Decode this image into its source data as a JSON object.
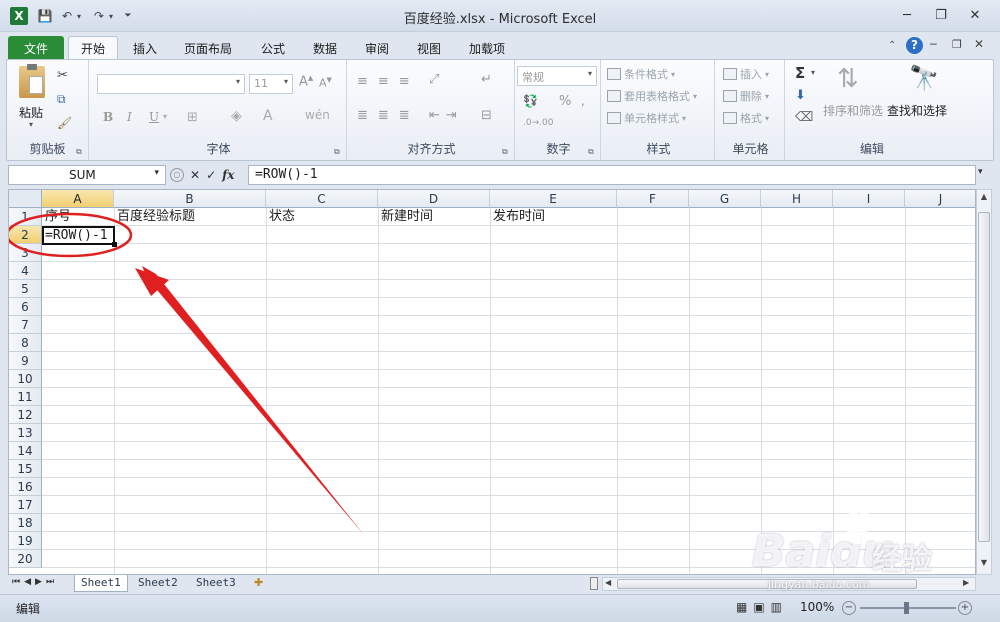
{
  "window": {
    "title": "百度经验.xlsx - Microsoft Excel",
    "controls": [
      "minimize",
      "restore",
      "close"
    ]
  },
  "ribbon_tabs": [
    "文件",
    "开始",
    "插入",
    "页面布局",
    "公式",
    "数据",
    "审阅",
    "视图",
    "加载项"
  ],
  "active_tab": "开始",
  "ribbon": {
    "clipboard": {
      "paste": "粘贴",
      "label": "剪贴板"
    },
    "font": {
      "font_size": "11",
      "label": "字体"
    },
    "alignment": {
      "label": "对齐方式"
    },
    "number": {
      "format": "常规",
      "label": "数字",
      "percent": "%"
    },
    "styles": {
      "conditional": "条件格式",
      "table": "套用表格格式",
      "cell_styles": "单元格样式",
      "label": "样式"
    },
    "cells": {
      "insert": "插入",
      "delete": "删除",
      "format": "格式",
      "label": "单元格"
    },
    "editing": {
      "sort": "排序和筛选",
      "find": "查找和选择",
      "label": "编辑",
      "sigma": "Σ"
    }
  },
  "formula_bar": {
    "name_box": "SUM",
    "fx": "fx",
    "formula": "=ROW()-1"
  },
  "columns": [
    "A",
    "B",
    "C",
    "D",
    "E",
    "F",
    "G",
    "H",
    "I",
    "J"
  ],
  "rows": [
    "1",
    "2",
    "3",
    "4",
    "5",
    "6",
    "7",
    "8",
    "9",
    "10",
    "11",
    "12",
    "13",
    "14",
    "15",
    "16",
    "17",
    "18",
    "19",
    "20"
  ],
  "cells": {
    "A1": "序号",
    "B1": "百度经验标题",
    "C1": "状态",
    "D1": "新建时间",
    "E1": "发布时间",
    "A2": "=ROW()-1"
  },
  "active_cell": "A2",
  "sheet_tabs": [
    "Sheet1",
    "Sheet2",
    "Sheet3"
  ],
  "active_sheet": "Sheet1",
  "status": {
    "mode": "编辑",
    "zoom": "100%"
  },
  "watermark": {
    "brand": "Baidu",
    "cn": "经验",
    "url": "jingyan.baidu.com"
  },
  "colors": {
    "file_tab": "#2a8c37",
    "annotation": "#e02020",
    "selected_header": "#f1cf70"
  }
}
